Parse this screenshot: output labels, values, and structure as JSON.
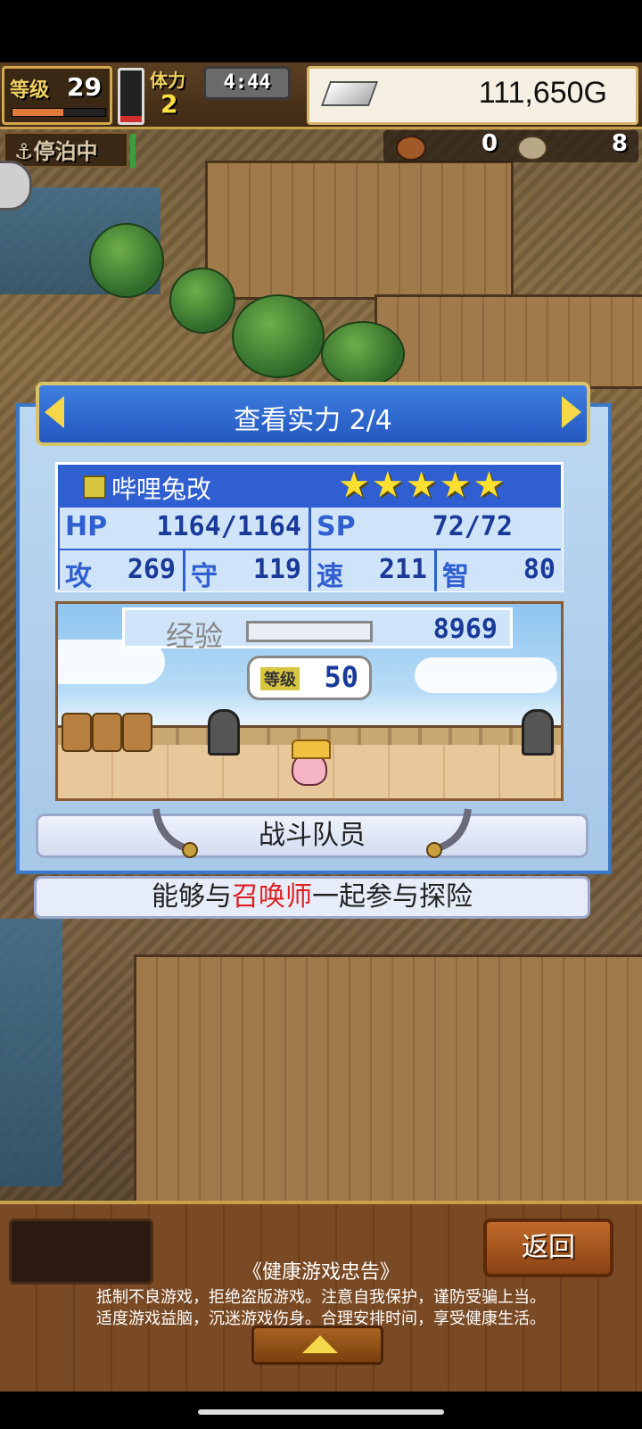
{
  "hud": {
    "level_label": "等级",
    "level_value": "29",
    "level_progress": 0.55,
    "stamina_label": "体力",
    "stamina_value": "2",
    "stamina_level": 0.12,
    "timer": "4:44",
    "money": "111,650G"
  },
  "status": {
    "dock_label": "⚓停泊中",
    "resource_1_value": "0",
    "resource_2_value": "8"
  },
  "dialog": {
    "title": "查看实力 2/4",
    "character_name": "哔哩兔改",
    "stars": "★★★★★",
    "stats": {
      "hp_label": "HP",
      "hp_value": "1164/1164",
      "sp_label": "SP",
      "sp_value": "72/72",
      "atk_label": "攻",
      "atk_value": "269",
      "def_label": "守",
      "def_value": "119",
      "spd_label": "速",
      "spd_value": "211",
      "int_label": "智",
      "int_value": "80"
    },
    "exp_label": "经验",
    "exp_value": "8969",
    "level_bubble_label": "等级",
    "level_bubble_value": "50",
    "role": "战斗队员",
    "description_prefix": "能够与",
    "description_highlight": "召唤师",
    "description_suffix": "一起参与探险"
  },
  "bottom": {
    "back_label": "返回",
    "notice_title": "《健康游戏忠告》",
    "notice_line_1": "抵制不良游戏，拒绝盗版游戏。注意自我保护，谨防受骗上当。",
    "notice_line_2": "适度游戏益脑，沉迷游戏伤身。合理安排时间，享受健康生活。"
  },
  "colors": {
    "accent_blue": "#2f5fd0",
    "highlight_red": "#e02020",
    "star_gold": "#ffe030"
  }
}
